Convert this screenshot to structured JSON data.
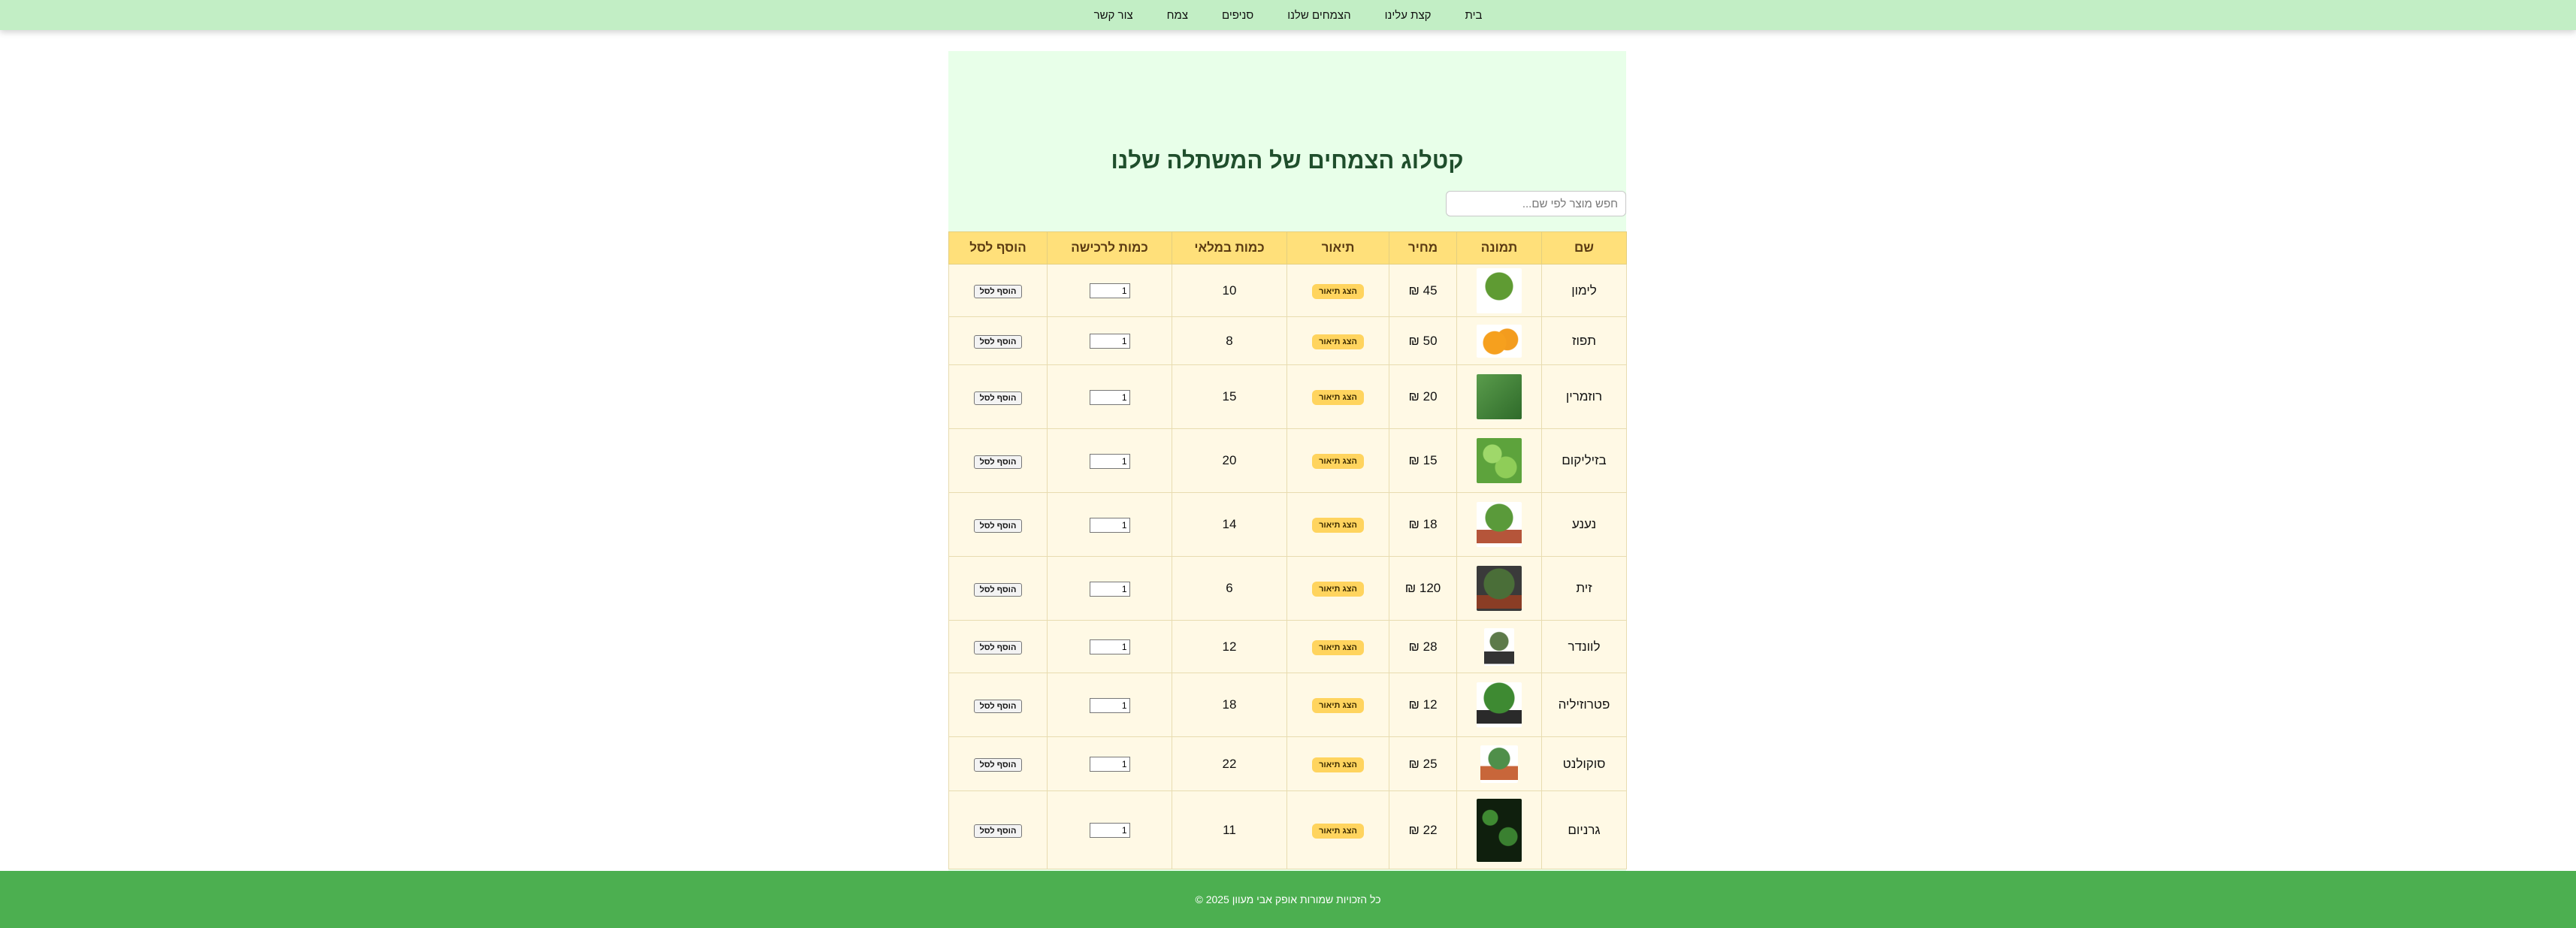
{
  "nav": {
    "items": [
      "בית",
      "קצת עלינו",
      "הצמחים שלנו",
      "סניפים",
      "צמח",
      "צור קשר"
    ]
  },
  "main": {
    "title": "קטלוג הצמחים של המשתלה שלנו",
    "search_placeholder": "חפש מוצר לפי שם...",
    "headers": {
      "name": "שם",
      "image": "תמונה",
      "price": "מחיר",
      "description": "תיאור",
      "stock": "כמות במלאי",
      "quantity": "כמות לרכישה",
      "add": "הוסף לסל"
    },
    "desc_button_label": "הצג תיאור",
    "add_button_label": "הוסף לסל",
    "default_quantity": "1"
  },
  "products": [
    {
      "name": "לימון",
      "price": "45 ₪",
      "stock": "10",
      "image_icon": "lemon-tree-icon",
      "color": "#4c7d2f"
    },
    {
      "name": "תפוז",
      "price": "50 ₪",
      "stock": "8",
      "image_icon": "orange-fruit-icon",
      "color": "#f39c1e"
    },
    {
      "name": "רוזמרין",
      "price": "20 ₪",
      "stock": "15",
      "image_icon": "rosemary-icon",
      "color": "#4e8a44"
    },
    {
      "name": "בזיליקום",
      "price": "15 ₪",
      "stock": "20",
      "image_icon": "basil-icon",
      "color": "#7cc04c"
    },
    {
      "name": "נענע",
      "price": "18 ₪",
      "stock": "14",
      "image_icon": "mint-pot-icon",
      "color": "#5a9a3a"
    },
    {
      "name": "זית",
      "price": "120 ₪",
      "stock": "6",
      "image_icon": "olive-tree-icon",
      "color": "#3f5a33"
    },
    {
      "name": "לוונדר",
      "price": "28 ₪",
      "stock": "12",
      "image_icon": "lavender-icon",
      "color": "#5d7a4a"
    },
    {
      "name": "פטרוזיליה",
      "price": "12 ₪",
      "stock": "18",
      "image_icon": "parsley-icon",
      "color": "#3e8a32"
    },
    {
      "name": "סוקולנט",
      "price": "25 ₪",
      "stock": "22",
      "image_icon": "succulent-icon",
      "color": "#4f8f4a"
    },
    {
      "name": "גרניום",
      "price": "22 ₪",
      "stock": "11",
      "image_icon": "geranium-icon",
      "color": "#2e6b27"
    }
  ],
  "footer": {
    "text": "כל הזכויות שמורות אופק אבי מעוון 2025 ©"
  }
}
